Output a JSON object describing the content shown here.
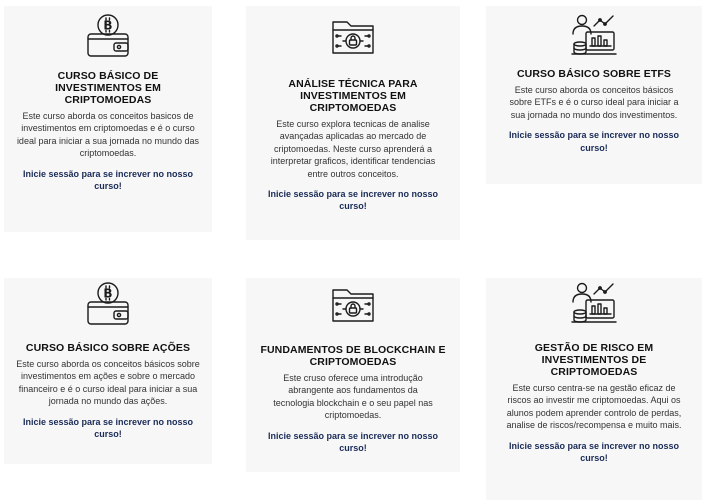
{
  "courses": [
    {
      "icon": "bitcoin-wallet-icon",
      "title": "CURSO BÁSICO DE INVESTIMENTOS EM CRIPTOMOEDAS",
      "description": "Este curso aborda os conceitos basicos de investimentos em criptomoedas e é o curso ideal para iniciar a sua jornada no mundo das criptomoedas.",
      "link": "Inicie sessão para se increver no nosso curso!"
    },
    {
      "icon": "crypto-folder-icon",
      "title": "ANÁLISE TÉCNICA PARA INVESTIMENTOS EM CRIPTOMOEDAS",
      "description": "Este curso explora tecnicas de analise avançadas aplicadas ao mercado de criptomoedas. Neste curso aprenderá a interpretar graficos, identificar tendencias entre outros conceitos.",
      "link": "Inicie sessão para se increver no nosso curso!"
    },
    {
      "icon": "investor-chart-icon",
      "title": "CURSO BÁSICO SOBRE ETFS",
      "description": "Este curso aborda os conceitos básicos sobre ETFs e é o curso ideal para iniciar a sua jornada no mundo dos investimentos.",
      "link": "Inicie sessão para se increver no nosso curso!"
    },
    {
      "icon": "bitcoin-wallet-icon",
      "title": "CURSO BÁSICO SOBRE AÇÕES",
      "description": "Este curso aborda os conceitos básicos sobre investimentos em ações e sobre o mercado financeiro e é o curso ideal para iniciar a sua jornada no mundo das ações.",
      "link": "Inicie sessão para se increver no nosso curso!"
    },
    {
      "icon": "crypto-folder-icon",
      "title": "FUNDAMENTOS DE BLOCKCHAIN E CRIPTOMOEDAS",
      "description": "Este cruso oferece uma introdução abrangente aos fundamentos da tecnologia blockchain e o seu papel nas criptomoedas.",
      "link": "Inicie sessão para se increver no nosso curso!"
    },
    {
      "icon": "investor-chart-icon",
      "title": "GESTÃO DE RISCO EM INVESTIMENTOS DE CRIPTOMOEDAS",
      "description": "Este curso centra-se na gestão eficaz de riscos ao investir me criptomoedas. Aqui os alunos podem aprender controlo de perdas, analise de riscos/recompensa e muito mais.",
      "link": "Inicie sessão para se increver no nosso curso!"
    }
  ]
}
